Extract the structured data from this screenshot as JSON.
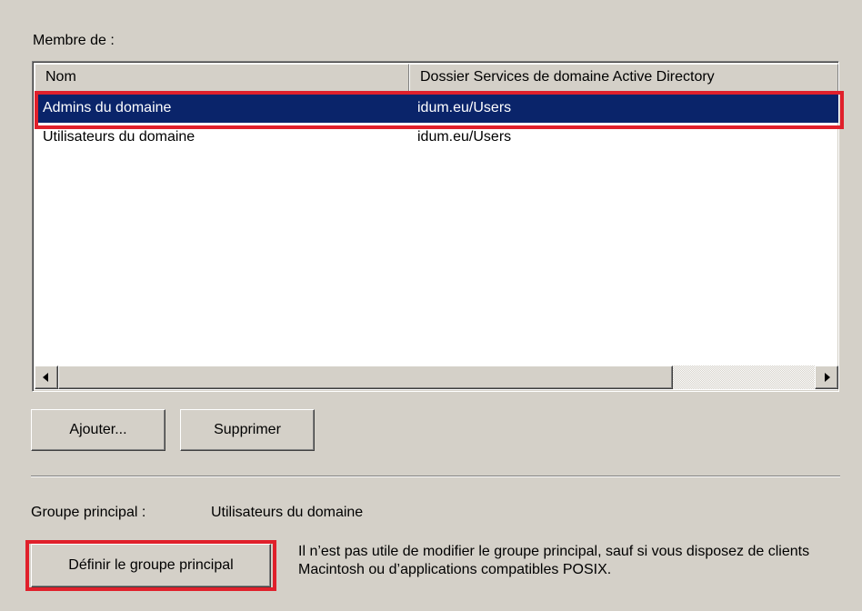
{
  "member_of": {
    "label": "Membre de :",
    "columns": [
      "Nom",
      "Dossier Services de domaine Active Directory"
    ],
    "rows": [
      {
        "name": "Admins du domaine",
        "folder": "idum.eu/Users",
        "selected": true
      },
      {
        "name": "Utilisateurs du domaine",
        "folder": "idum.eu/Users",
        "selected": false
      }
    ]
  },
  "buttons": {
    "add": "Ajouter...",
    "remove": "Supprimer",
    "set_primary": "Définir le groupe principal"
  },
  "primary_group": {
    "label": "Groupe principal :",
    "value": "Utilisateurs du domaine"
  },
  "note": "Il n’est pas utile de modifier le groupe principal, sauf si vous disposez de clients Macintosh ou d’applications compatibles POSIX.",
  "colors": {
    "selection": "#0a246a",
    "highlight_box": "#e0202b",
    "dialog_background": "#d4d0c8"
  }
}
